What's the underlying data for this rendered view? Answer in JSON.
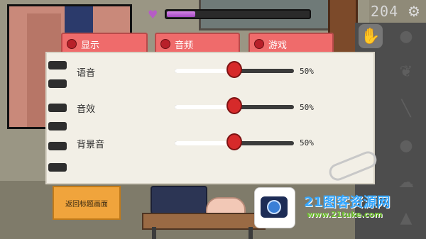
{
  "hud": {
    "health_fill": 0.2,
    "counter": "204",
    "icons": {
      "heart": "heart-icon",
      "settings": "gear-icon"
    },
    "colors": {
      "health": "#b65cc6"
    }
  },
  "tabs": [
    {
      "label": "显示"
    },
    {
      "label": "音频"
    },
    {
      "label": "游戏"
    }
  ],
  "settings": {
    "rows": [
      {
        "label": "语音",
        "value": 0.5,
        "value_text": "50%"
      },
      {
        "label": "音效",
        "value": 0.5,
        "value_text": "50%"
      },
      {
        "label": "背景音",
        "value": 0.5,
        "value_text": "50%"
      }
    ]
  },
  "return_button": {
    "label": "返回标题画面"
  },
  "tools": [
    "hand-icon",
    "leaf-icon",
    "bra-icon",
    "stick-icon",
    "blob-icon",
    "speech-icon",
    "bottle-icon"
  ],
  "watermark": {
    "brand": "21图客资源网",
    "url": "www.21tuke.com"
  }
}
